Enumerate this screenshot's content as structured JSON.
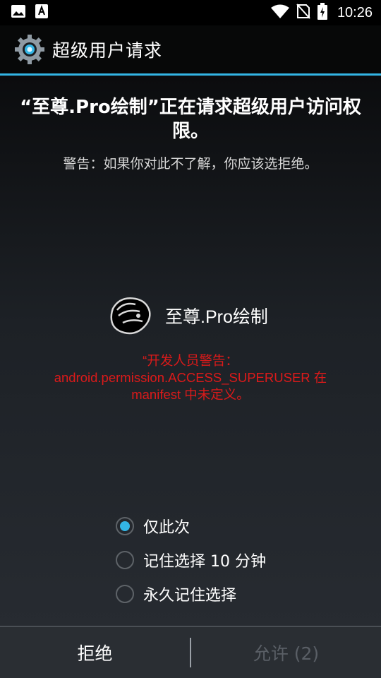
{
  "status_bar": {
    "time": "10:26",
    "icons": [
      "image-icon",
      "text-a-icon",
      "wifi-icon",
      "no-sim-icon",
      "battery-charging-icon"
    ]
  },
  "header": {
    "title": "超级用户请求",
    "icon": "gear-icon",
    "accent_color": "#33b5e5"
  },
  "request": {
    "headline": "“至尊.Pro绘制”正在请求超级用户访问权限。",
    "warning": "警告：如果你对此不了解，你应该选拒绝。"
  },
  "app": {
    "name": "至尊.Pro绘制",
    "icon": "app-logo-icon"
  },
  "developer_warning": {
    "line1": "“开发人员警告：",
    "line2": "android.permission.ACCESS_SUPERUSER 在",
    "line3": "manifest 中未定义。",
    "color": "#dc1a1a"
  },
  "options": [
    {
      "label": "仅此次",
      "selected": true
    },
    {
      "label": "记住选择 10 分钟",
      "selected": false
    },
    {
      "label": "永久记住选择",
      "selected": false
    }
  ],
  "buttons": {
    "deny": "拒绝",
    "allow": "允许 (2)"
  }
}
